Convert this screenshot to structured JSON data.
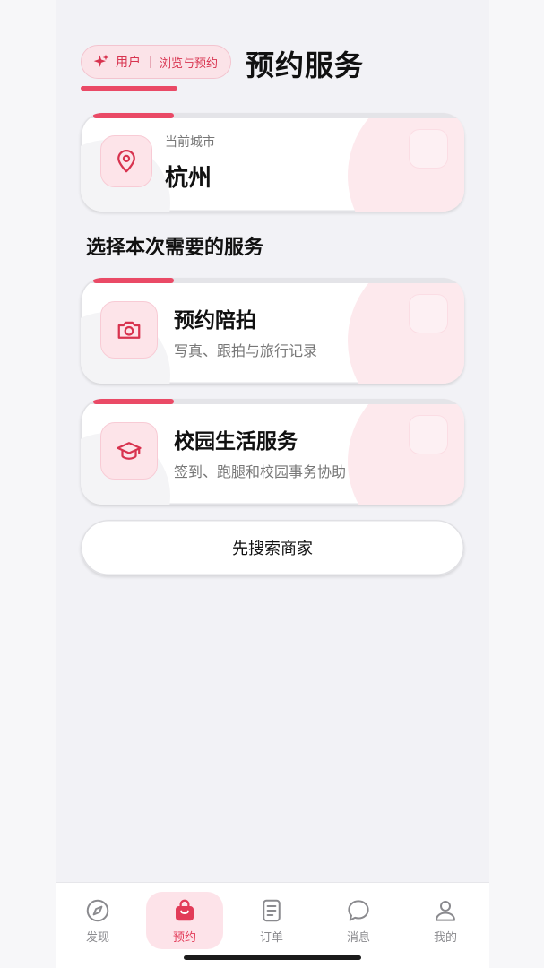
{
  "header": {
    "role": "用户",
    "mode": "浏览与预约",
    "title": "预约服务"
  },
  "city": {
    "label": "当前城市",
    "name": "杭州"
  },
  "section_title": "选择本次需要的服务",
  "services": [
    {
      "title": "预约陪拍",
      "desc": "写真、跟拍与旅行记录",
      "icon": "camera-icon"
    },
    {
      "title": "校园生活服务",
      "desc": "签到、跑腿和校园事务协助",
      "icon": "graduation-cap-icon"
    }
  ],
  "search_button": "先搜索商家",
  "tabs": [
    {
      "label": "发现",
      "icon": "compass-icon",
      "active": false
    },
    {
      "label": "预约",
      "icon": "shopping-bag-icon",
      "active": true
    },
    {
      "label": "订单",
      "icon": "document-icon",
      "active": false
    },
    {
      "label": "消息",
      "icon": "chat-bubble-icon",
      "active": false
    },
    {
      "label": "我的",
      "icon": "user-icon",
      "active": false
    }
  ],
  "colors": {
    "accent": "#ea4a66",
    "accent_soft": "#fde4e9",
    "background": "#f2f2f6"
  }
}
